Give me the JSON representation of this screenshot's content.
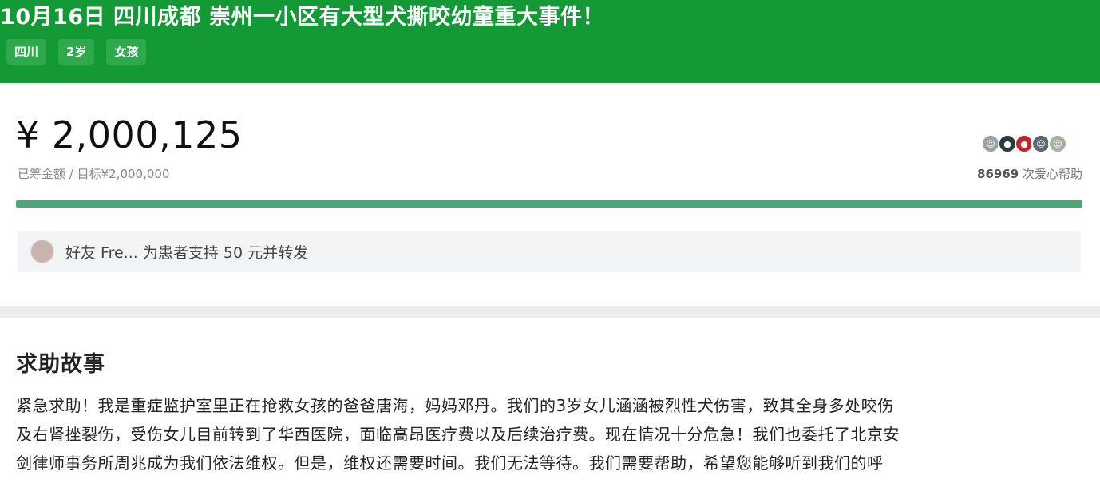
{
  "header": {
    "title": "10月16日 四川成都 崇州一小区有大型犬撕咬幼童重大事件！",
    "tags": [
      "四川",
      "2岁",
      "女孩"
    ]
  },
  "funding": {
    "amount": "¥ 2,000,125",
    "raised_label": "已筹金额 / 目标¥2,000,000",
    "helpers_count": "86969",
    "helpers_label": "次爱心帮助",
    "progress_fraction": 1.0,
    "progress_color": "#4aa878"
  },
  "friend_share": {
    "text": "好友 Fre... 为患者支持 50 元并转发"
  },
  "story": {
    "title": "求助故事",
    "lines": [
      "紧急求助！我是重症监护室里正在抢救女孩的爸爸唐海，妈妈邓丹。我们的3岁女儿涵涵被烈性犬伤害，致其全身多处咬伤",
      "及右肾挫裂伤，受伤女儿目前转到了华西医院，面临高昂医疗费以及后续治疗费。现在情况十分危急！我们也委托了北京安",
      "剑律师事务所周兆成为我们依法维权。但是，维权还需要时间。我们无法等待。我们需要帮助，希望您能够听到我们的呼"
    ]
  },
  "colors": {
    "brand": "#139a36",
    "tag_bg": "#2ea94c"
  }
}
